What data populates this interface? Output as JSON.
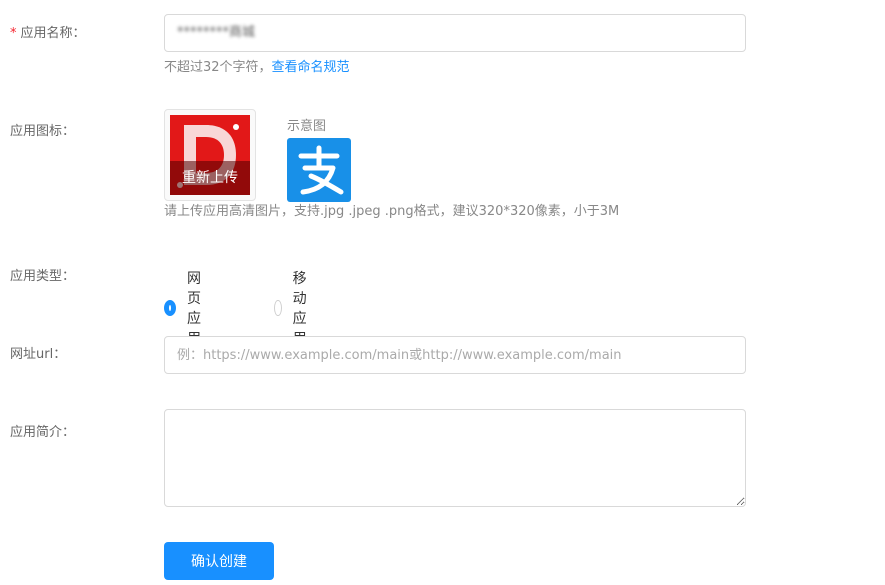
{
  "fields": {
    "name": {
      "required_mark": "*",
      "label": "应用名称：",
      "value": "********商城",
      "help_text": "不超过32个字符，",
      "help_link": "查看命名规范"
    },
    "icon": {
      "label": "应用图标：",
      "reupload_label": "重新上传",
      "preview_label": "示意图",
      "help_text": "请上传应用高清图片，支持.jpg .jpeg .png格式，建议320*320像素，小于3M"
    },
    "type": {
      "label": "应用类型：",
      "options": [
        {
          "label": "网页应用",
          "checked": true
        },
        {
          "label": "移动应用",
          "checked": false
        }
      ]
    },
    "url": {
      "label": "网址url：",
      "placeholder": "例：https://www.example.com/main或http://www.example.com/main"
    },
    "description": {
      "label": "应用简介：",
      "value": ""
    }
  },
  "submit_label": "确认创建",
  "colors": {
    "primary": "#1890ff",
    "required": "#f5222d",
    "icon_red": "#e21818",
    "preview_blue": "#1890e8"
  },
  "icons": {
    "uploaded": "app-logo-icon",
    "preview": "alipay-icon"
  }
}
